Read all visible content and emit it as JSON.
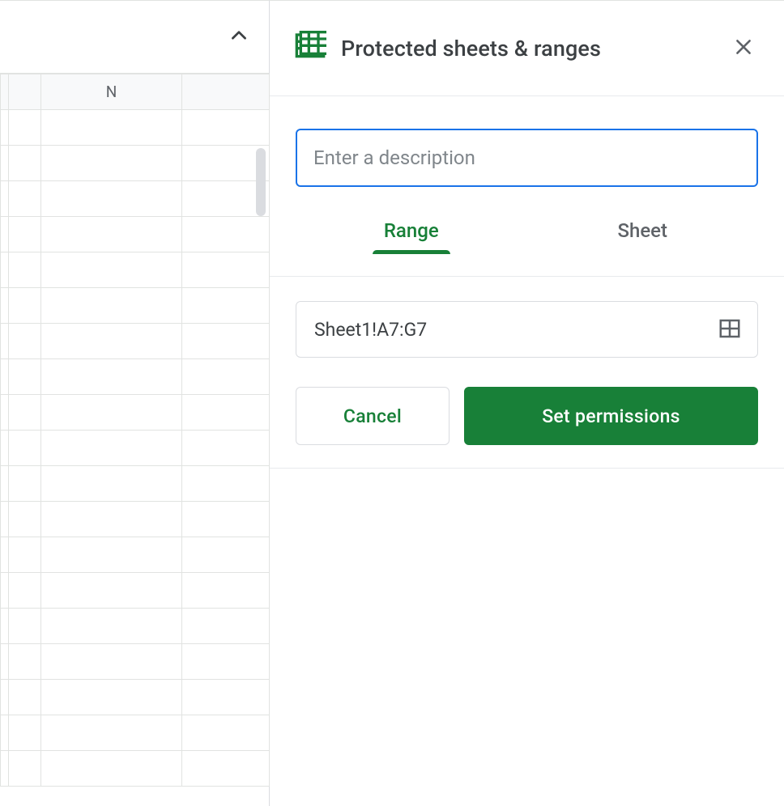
{
  "sheet": {
    "columns": [
      "",
      "",
      "N",
      ""
    ]
  },
  "panel": {
    "title": "Protected sheets & ranges",
    "description_value": "",
    "description_placeholder": "Enter a description",
    "tabs": {
      "range": "Range",
      "sheet": "Sheet",
      "active": "range"
    },
    "range_value": "Sheet1!A7:G7",
    "buttons": {
      "cancel": "Cancel",
      "set_permissions": "Set permissions"
    }
  }
}
